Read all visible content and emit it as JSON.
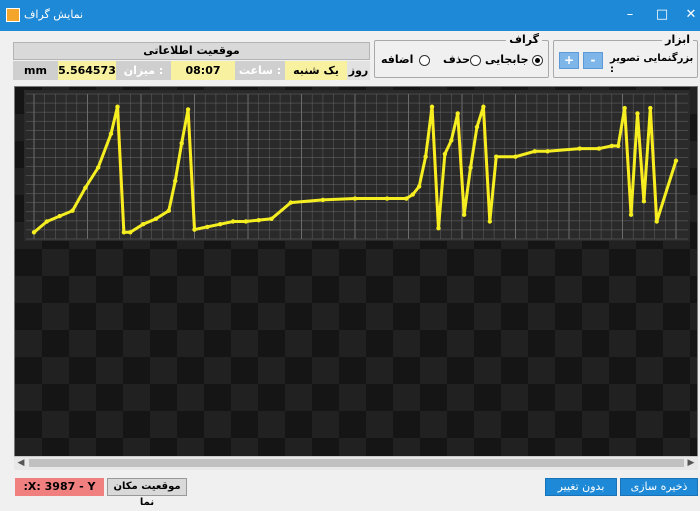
{
  "window": {
    "title": "نمایش گراف",
    "minimize": "–",
    "maximize": "□",
    "close": "✕"
  },
  "info": {
    "header": "موقعیت اطلاعاتی",
    "day_label": "روز :",
    "day_value": "یک شنبه",
    "time_label": "ساعت :",
    "time_value": "08:07",
    "amount_label": "میزان :",
    "amount_value": "5.564573",
    "unit": "mm"
  },
  "graph_group": {
    "legend": "گراف",
    "options": [
      {
        "label": "جابجایی",
        "selected": true
      },
      {
        "label": "حذف",
        "selected": false
      },
      {
        "label": "اضافه",
        "selected": false
      }
    ]
  },
  "tools_group": {
    "legend": "ابزار",
    "zoom_label": "بزرگنمایی تصویر :",
    "zoom_out": "-",
    "zoom_in": "+"
  },
  "chart_data": {
    "type": "line",
    "title": "",
    "xlabel": "",
    "ylabel": "",
    "grid": true,
    "series_color": "#f5ee21",
    "drop_color": "#cc1f1f",
    "x": [
      0,
      2,
      4,
      6,
      8,
      10,
      12,
      13,
      14,
      15,
      17,
      19,
      21,
      22,
      23,
      24,
      25,
      27,
      29,
      31,
      33,
      35,
      37,
      40,
      45,
      50,
      55,
      58,
      59,
      60,
      61,
      62,
      63,
      64,
      65,
      66,
      67,
      68,
      69,
      70,
      71,
      72,
      75,
      78,
      80,
      85,
      88,
      90,
      91,
      92,
      93,
      94,
      95,
      96,
      97,
      100
    ],
    "y": [
      2,
      10,
      14,
      18,
      35,
      50,
      75,
      95,
      2,
      2,
      8,
      12,
      18,
      40,
      68,
      93,
      4,
      6,
      8,
      10,
      10,
      11,
      12,
      24,
      26,
      27,
      27,
      27,
      30,
      36,
      58,
      95,
      5,
      60,
      70,
      90,
      15,
      50,
      80,
      95,
      10,
      58,
      58,
      62,
      62,
      64,
      64,
      66,
      66,
      94,
      15,
      90,
      25,
      94,
      10,
      55
    ]
  },
  "status": {
    "xy": ":X: 3987 - Y",
    "location_btn": "موقعیت مکان نما"
  },
  "actions": {
    "save": "ذخیره سازی",
    "no_change": "بدون تغییر"
  }
}
